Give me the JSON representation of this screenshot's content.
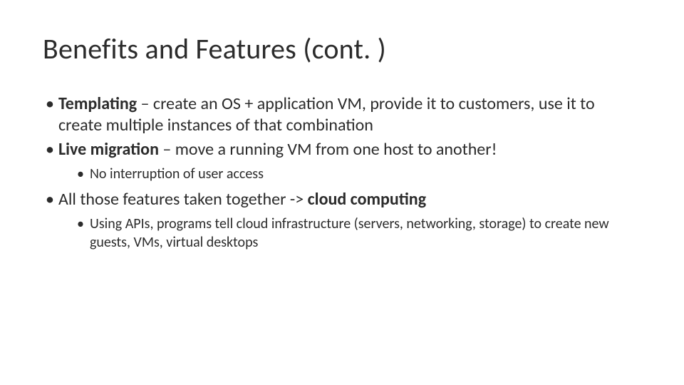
{
  "slide": {
    "title": "Benefits and Features (cont. )",
    "bullets": [
      {
        "bold": "Templating",
        "rest": " – create an OS + application VM, provide it to customers, use it to create multiple instances of that combination"
      },
      {
        "bold": "Live migration",
        "rest": " – move a running VM from one host to another!",
        "sub": [
          "No interruption of user access"
        ]
      },
      {
        "pre": "All those features taken together -> ",
        "bold": "cloud computing",
        "sub": [
          "Using APIs, programs tell cloud infrastructure (servers, networking, storage) to create new guests, VMs, virtual desktops"
        ]
      }
    ]
  }
}
